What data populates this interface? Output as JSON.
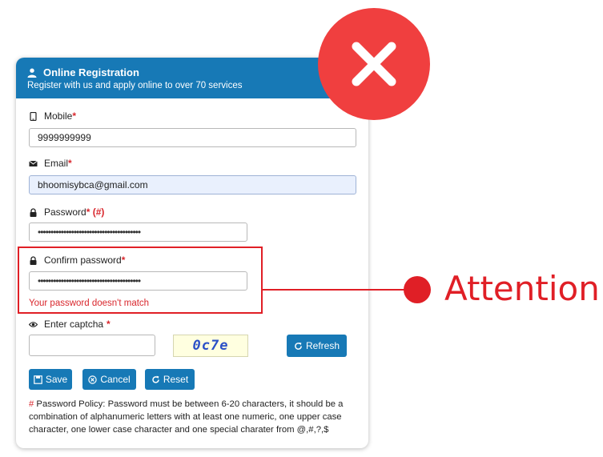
{
  "header": {
    "title": "Online Registration",
    "subtitle": "Register with us and apply online to over 70 services"
  },
  "form": {
    "mobile": {
      "label": "Mobile",
      "required_mark": "*",
      "value": "9999999999"
    },
    "email": {
      "label": "Email",
      "required_mark": "*",
      "value": "bhoomisybca@gmail.com"
    },
    "password": {
      "label": "Password",
      "required_mark": "* (#)",
      "value": "••••••••••••••••••••••••••••••••••••••••"
    },
    "confirm_password": {
      "label": "Confirm password",
      "required_mark": "*",
      "value": "••••••••••••••••••••••••••••••••••••••••"
    },
    "error": "Your password doesn't match",
    "captcha": {
      "label": "Enter captcha",
      "required_mark": "*",
      "value": "",
      "image_text": "0c7e"
    },
    "refresh_label": "Refresh"
  },
  "actions": {
    "save_label": "Save",
    "cancel_label": "Cancel",
    "reset_label": "Reset"
  },
  "policy": {
    "hash": "#",
    "text": " Password Policy: Password must be between 6-20 characters, it should be a combination of alphanumeric letters with at least one numeric, one upper case character, one lower case character and one special charater from @,#,?,$"
  },
  "annotation": {
    "attention": "Attention"
  },
  "colors": {
    "primary": "#1779b6",
    "error": "#e01f26",
    "close": "#f03f3f"
  }
}
